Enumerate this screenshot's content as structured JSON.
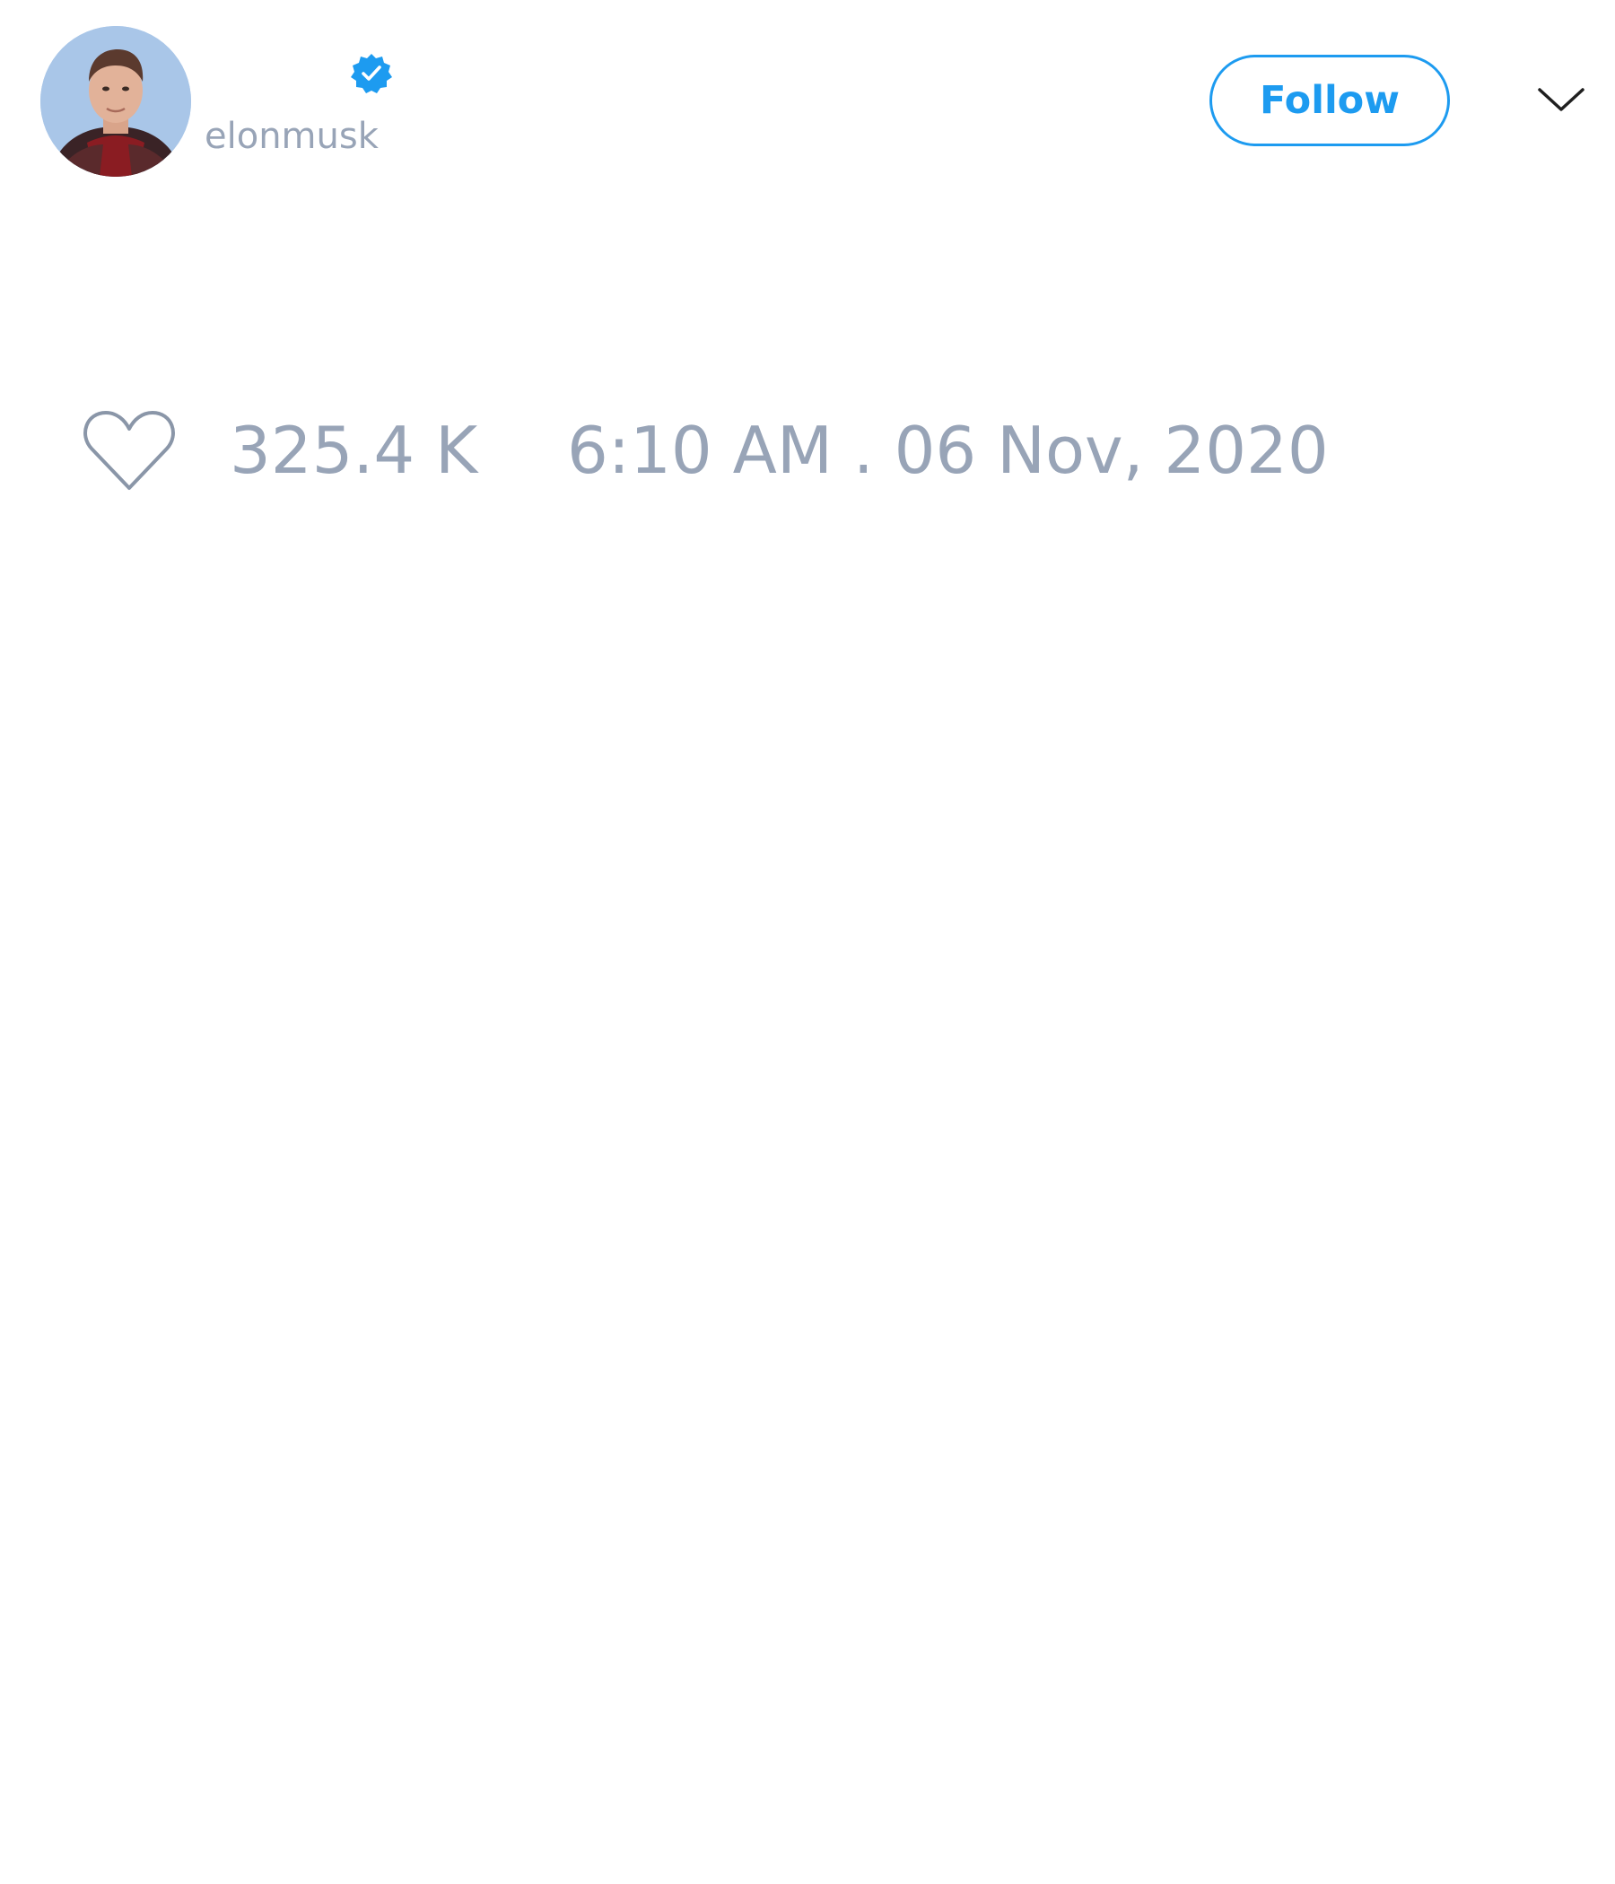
{
  "tweet": {
    "author": {
      "handle": "elonmusk",
      "verified": true,
      "avatar_description": "profile photo"
    },
    "follow_button_label": "Follow",
    "likes": "325.4 K",
    "timestamp": "6:10 AM . 06 Nov, 2020"
  },
  "icons": {
    "verified": "verified-badge-icon",
    "menu": "chevron-down-icon",
    "like": "heart-icon"
  },
  "colors": {
    "accent": "#1d9bf0",
    "muted_text": "#98a4b7",
    "icon_stroke": "#8a96a8"
  }
}
